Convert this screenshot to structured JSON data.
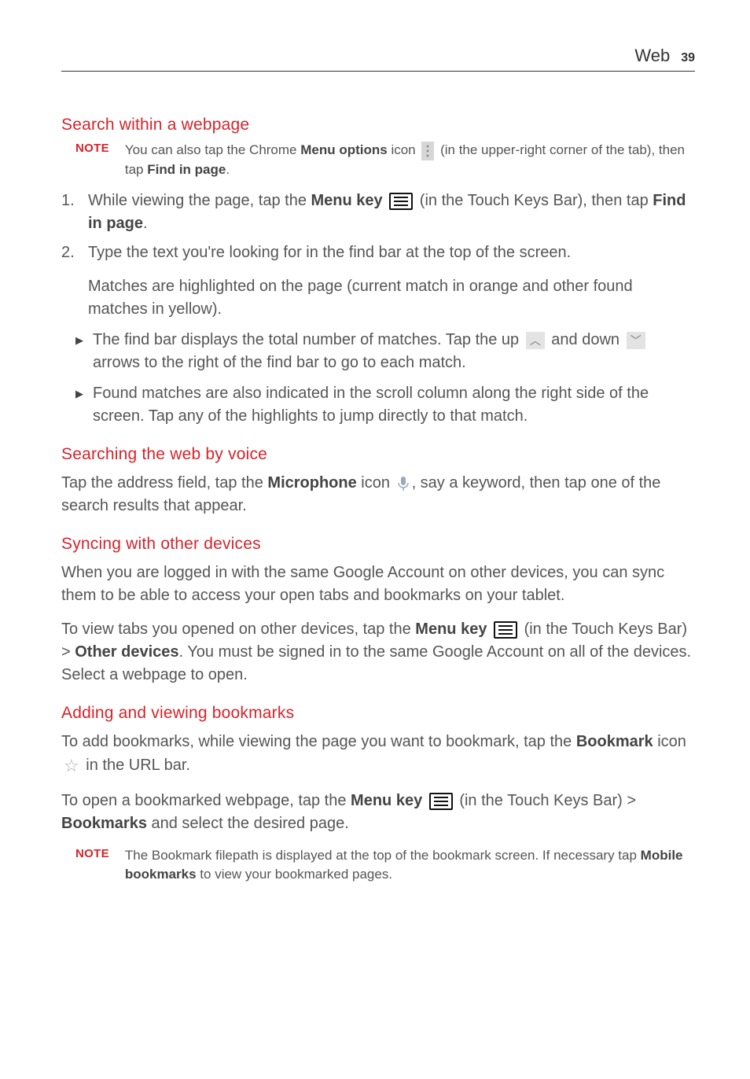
{
  "header": {
    "section": "Web",
    "page": "39"
  },
  "sec1": {
    "title": "Search within a webpage",
    "note_label": "NOTE",
    "note_p1": "You can also tap the Chrome ",
    "note_b1": "Menu options",
    "note_p2": " icon ",
    "note_p3": " (in the upper-right corner of the tab), then tap ",
    "note_b2": "Find in page",
    "note_p4": ".",
    "s1_num": "1.",
    "s1_a": "While viewing the page, tap the ",
    "s1_b": "Menu key",
    "s1_c": " (in the Touch Keys Bar), then tap ",
    "s1_d": "Find in page",
    "s1_e": ".",
    "s2_num": "2.",
    "s2_a": "Type the text you're looking for in the find bar at the top of the screen.",
    "s2_sub": "Matches are highlighted on the page (current match in orange and other found matches in yellow).",
    "b1_a": "The find bar displays the total number of matches. Tap the up ",
    "b1_b": " and down ",
    "b1_c": " arrows to the right of the find bar to go to each match.",
    "b2": "Found matches are also indicated in the scroll column along the right side of the screen. Tap any of the highlights to jump directly to that match."
  },
  "sec2": {
    "title": "Searching the web by voice",
    "p_a": "Tap the address field, tap the ",
    "p_b": "Microphone",
    "p_c": " icon ",
    "p_d": ", say a keyword, then tap one of the search results that appear."
  },
  "sec3": {
    "title": "Syncing with other devices",
    "p1": "When you are logged in with the same Google Account on other devices, you can sync them to be able to access your open tabs and bookmarks on your tablet.",
    "p2_a": "To view tabs you opened on other devices, tap the ",
    "p2_b": "Menu key",
    "p2_c": " (in the Touch Keys Bar) > ",
    "p2_d": "Other devices",
    "p2_e": ". You must be signed in to the same Google Account on all of the devices. Select a webpage to open."
  },
  "sec4": {
    "title": "Adding and viewing bookmarks",
    "p1_a": "To add bookmarks, while viewing the page you want to bookmark, tap the ",
    "p1_b": "Bookmark",
    "p1_c": " icon ",
    "p1_d": " in the URL bar.",
    "p2_a": "To open a bookmarked webpage, tap the ",
    "p2_b": "Menu key",
    "p2_c": " (in the Touch Keys Bar) > ",
    "p2_d": "Bookmarks",
    "p2_e": " and select the desired page.",
    "note_label": "NOTE",
    "note_a": "The Bookmark filepath is displayed at the top of the bookmark screen. If necessary tap ",
    "note_b": "Mobile bookmarks",
    "note_c": " to view your bookmarked pages."
  }
}
